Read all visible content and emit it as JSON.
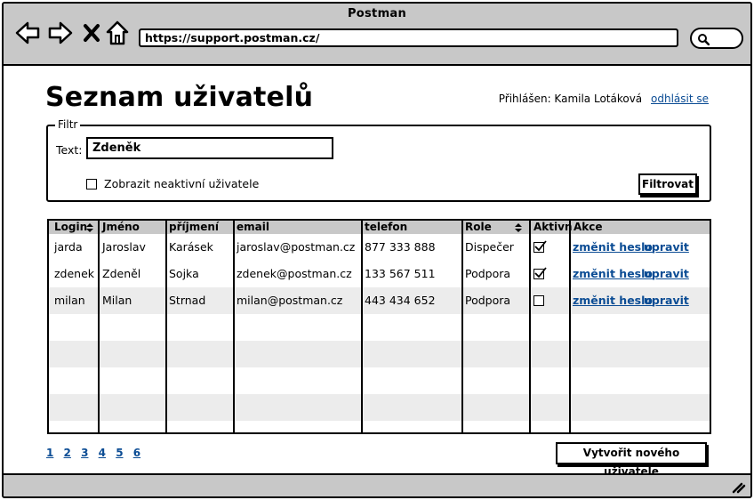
{
  "window": {
    "title": "Postman",
    "url": "https://support.postman.cz/"
  },
  "page": {
    "title": "Seznam uživatelů",
    "logged_in_label": "Přihlášen: Kamila Lotáková",
    "logout_link": "odhlásit se"
  },
  "filter": {
    "legend": "Filtr",
    "text_label": "Text:",
    "text_value": "Zdeněk",
    "inactive_label": "Zobrazit neaktivní uživatele",
    "inactive_checked": false,
    "button": "Filtrovat"
  },
  "table": {
    "headers": [
      "Login",
      "Jméno",
      "příjmení",
      "email",
      "telefon",
      "Role",
      "Aktivn",
      "Akce"
    ],
    "rows": [
      {
        "login": "jarda",
        "jmeno": "Jaroslav",
        "prijmeni": "Karásek",
        "email": "jaroslav@postman.cz",
        "telefon": "877 333 888",
        "role": "Dispečer",
        "aktivni": true,
        "change_pw": "změnit heslo",
        "edit": "upravit"
      },
      {
        "login": "zdenek",
        "jmeno": "Zdeněl",
        "prijmeni": "Sojka",
        "email": "zdenek@postman.cz",
        "telefon": "133 567 511",
        "role": "Podpora",
        "aktivni": true,
        "change_pw": "změnit heslo",
        "edit": "upravit"
      },
      {
        "login": "milan",
        "jmeno": "Milan",
        "prijmeni": "Strnad",
        "email": "milan@postman.cz",
        "telefon": "443 434 652",
        "role": "Podpora",
        "aktivni": false,
        "change_pw": "změnit heslo",
        "edit": "upravit"
      }
    ]
  },
  "pagination": {
    "pages": [
      "1",
      "2",
      "3",
      "4",
      "5",
      "6"
    ]
  },
  "actions": {
    "create_user": "Vytvořit nového uživatele"
  },
  "icons": {
    "back": "back-arrow-icon",
    "forward": "forward-arrow-icon",
    "close": "close-icon",
    "home": "home-icon",
    "search": "search-icon",
    "sort": "sort-icon",
    "check": "check-icon",
    "resize": "resize-grip-icon"
  },
  "colors": {
    "chrome": "#c8c8c8",
    "link": "#0b4c94",
    "row_alt": "#ececec"
  }
}
